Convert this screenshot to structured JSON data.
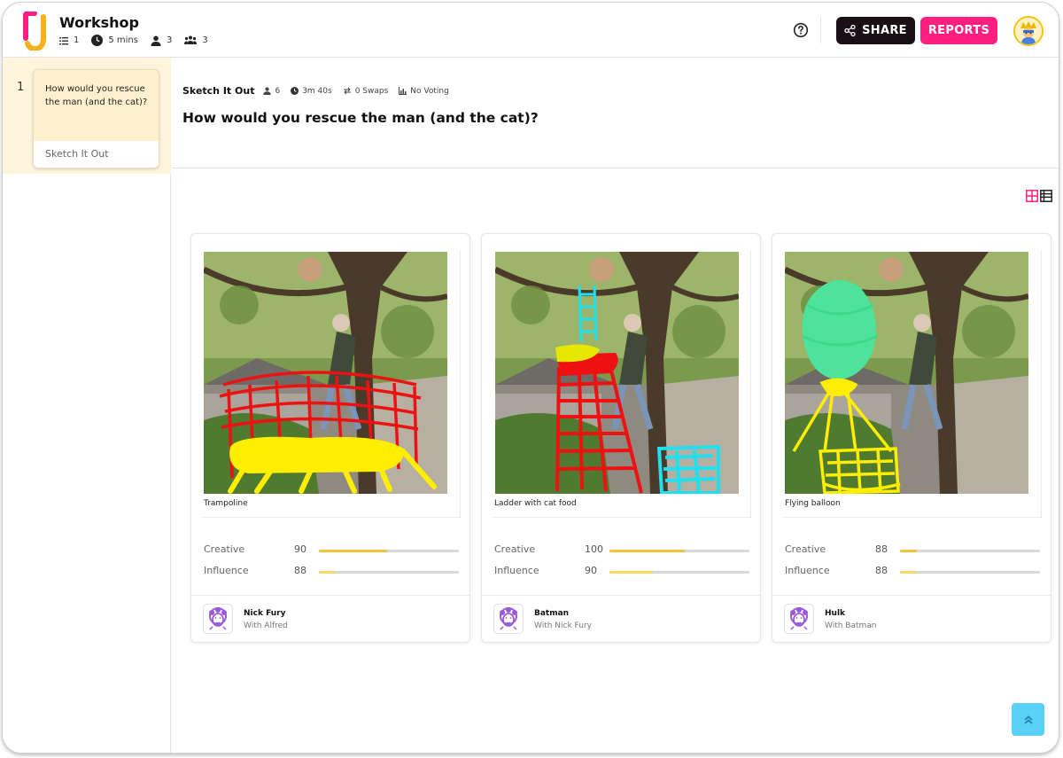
{
  "header": {
    "app_title": "Workshop",
    "meta": {
      "activities": "1",
      "duration": "5 mins",
      "participants": "3",
      "teams": "3"
    },
    "share_label": "SHARE",
    "reports_label": "REPORTS"
  },
  "sidebar": {
    "items": [
      {
        "number": "1",
        "question": "How would you rescue the man (and the cat)?",
        "label": "Sketch It Out"
      }
    ]
  },
  "activity": {
    "name": "Sketch It Out",
    "participants": "6",
    "time": "3m 40s",
    "swaps": "0 Swaps",
    "voting": "No Voting",
    "question": "How would you rescue the man (and the cat)?"
  },
  "ideas": [
    {
      "caption": "Trampoline",
      "creative_label": "Creative",
      "creative": "90",
      "creative_fill": 0.49,
      "influence_label": "Influence",
      "influence": "88",
      "influence_fill": 0.12,
      "team": "Nick Fury",
      "with": "With Alfred"
    },
    {
      "caption": "Ladder with cat food",
      "creative_label": "Creative",
      "creative": "100",
      "creative_fill": 0.54,
      "influence_label": "Influence",
      "influence": "90",
      "influence_fill": 0.31,
      "team": "Batman",
      "with": "With Nick Fury"
    },
    {
      "caption": "Flying balloon",
      "creative_label": "Creative",
      "creative": "88",
      "creative_fill": 0.12,
      "influence_label": "Influence",
      "influence": "88",
      "influence_fill": 0.12,
      "team": "Hulk",
      "with": "With Batman"
    }
  ],
  "colors": {
    "accent_pink": "#ff1f80",
    "bar_yellow": "#f6c23e",
    "bar_yellow_light": "#ffd866",
    "sidebar_highlight": "#fff4dc",
    "scroll_button": "#5ad1f7"
  },
  "icons": [
    "list-icon",
    "clock-icon",
    "person-icon",
    "group-icon",
    "help-icon",
    "share-icon",
    "swap-icon",
    "chart-icon",
    "grid-view-icon",
    "list-view-icon",
    "team-avatar-icon",
    "chevrons-up-icon"
  ]
}
